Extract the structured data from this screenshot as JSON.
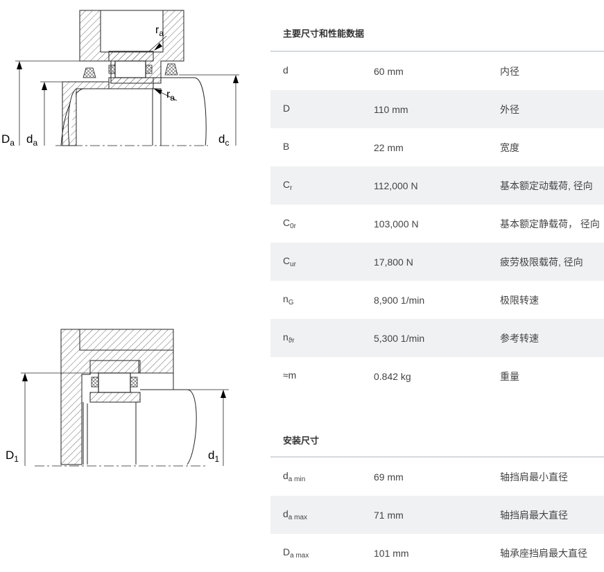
{
  "drawing_labels": {
    "ra_top": "r",
    "ra_top_sub": "a",
    "ra_mid": "r",
    "ra_mid_sub": "a",
    "Da": "D",
    "Da_sub": "a",
    "da": "d",
    "da_sub": "a",
    "dc": "d",
    "dc_sub": "c",
    "D1": "D",
    "D1_sub": "1",
    "d1": "d",
    "d1_sub": "1"
  },
  "section1": {
    "title": "主要尺寸和性能数据",
    "rows": [
      {
        "sym": "d",
        "sub": "",
        "value": "60 mm",
        "desc": "内径"
      },
      {
        "sym": "D",
        "sub": "",
        "value": "110 mm",
        "desc": "外径"
      },
      {
        "sym": "B",
        "sub": "",
        "value": "22 mm",
        "desc": "宽度"
      },
      {
        "sym": "C",
        "sub": "r",
        "value": "112,000 N",
        "desc": "基本额定动载荷, 径向"
      },
      {
        "sym": "C",
        "sub": "0r",
        "value": "103,000 N",
        "desc": "基本额定静载荷， 径向"
      },
      {
        "sym": "C",
        "sub": "ur",
        "value": "17,800 N",
        "desc": "疲劳极限载荷, 径向"
      },
      {
        "sym": "n",
        "sub": "G",
        "value": "8,900 1/min",
        "desc": "极限转速"
      },
      {
        "sym": "n",
        "sub": "ϑr",
        "value": "5,300 1/min",
        "desc": "参考转速"
      },
      {
        "sym": "≈m",
        "sub": "",
        "value": "0.842 kg",
        "desc": "重量"
      }
    ]
  },
  "section2": {
    "title": "安装尺寸",
    "rows": [
      {
        "sym": "d",
        "sub": "a min",
        "value": "69 mm",
        "desc": "轴挡肩最小直径"
      },
      {
        "sym": "d",
        "sub": "a max",
        "value": "71 mm",
        "desc": "轴挡肩最大直径"
      },
      {
        "sym": "D",
        "sub": "a max",
        "value": "101 mm",
        "desc": "轴承座挡肩最大直径"
      }
    ]
  }
}
